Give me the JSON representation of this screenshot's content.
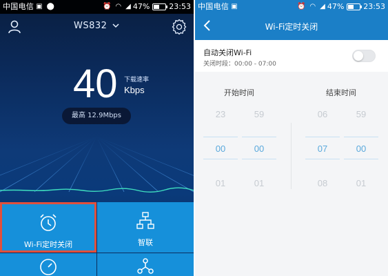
{
  "left": {
    "status": {
      "carrier": "中国电信",
      "battery": "47%",
      "time": "23:53"
    },
    "network_name": "WS832",
    "speed": {
      "value": "40",
      "label": "下载速率",
      "unit": "Kbps"
    },
    "peak": "最高 12.9Mbps",
    "tiles": [
      {
        "label": "Wi-Fi定时关闭",
        "icon": "alarm-clock-icon"
      },
      {
        "label": "智联",
        "icon": "network-tree-icon"
      },
      {
        "label": "",
        "icon": "speed-gauge-icon"
      },
      {
        "label": "",
        "icon": "network-topology-icon"
      }
    ],
    "colors": {
      "accent": "#1690da",
      "highlight": "#e0503c",
      "header": "#1b7fc7"
    }
  },
  "right": {
    "status": {
      "carrier": "中国电信",
      "battery": "47%",
      "time": "23:53"
    },
    "title": "Wi-Fi定时关闭",
    "auto_title": "自动关闭Wi-Fi",
    "auto_sub": "关闭时段：00:00 - 07:00",
    "toggle_on": false,
    "start_label": "开始时间",
    "end_label": "结束时间",
    "start_hours": [
      "23",
      "00",
      "01"
    ],
    "start_minutes": [
      "59",
      "00",
      "01"
    ],
    "end_hours": [
      "06",
      "07",
      "08"
    ],
    "end_minutes": [
      "59",
      "00",
      "01"
    ]
  }
}
